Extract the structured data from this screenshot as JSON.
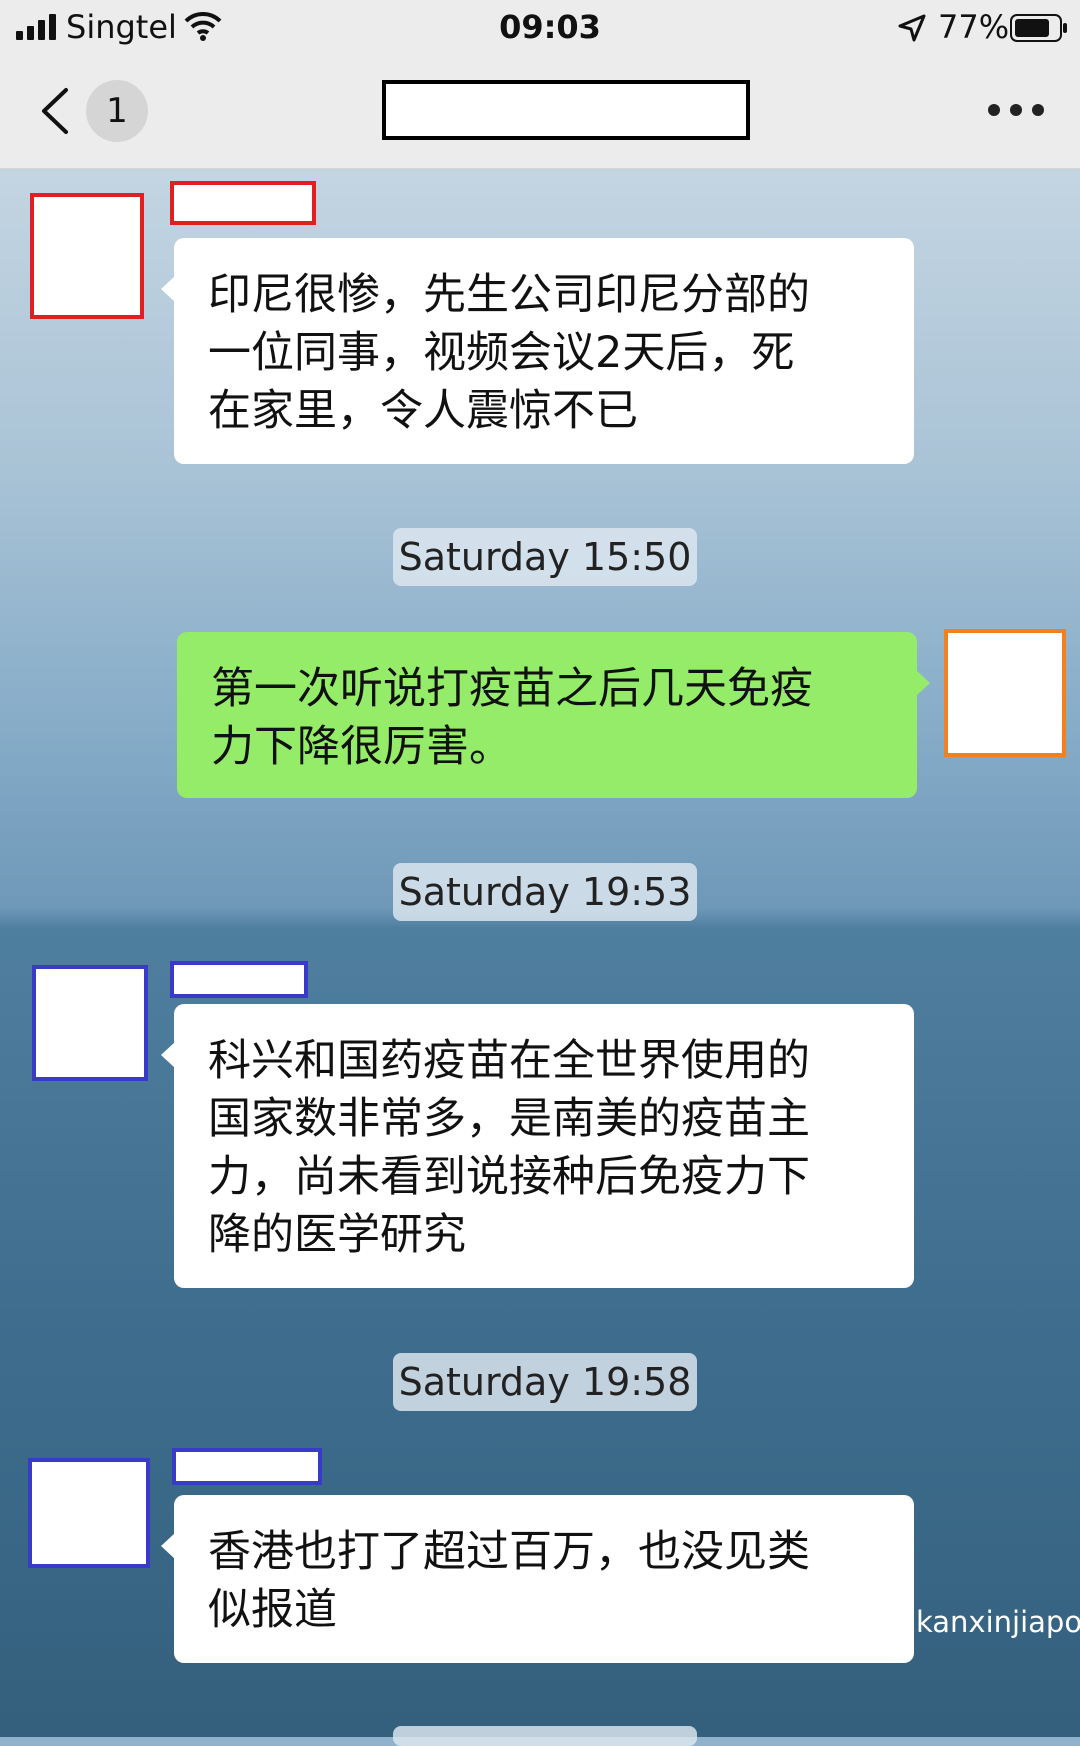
{
  "status_bar": {
    "carrier": "Singtel",
    "time": "09:03",
    "battery": "77%"
  },
  "nav": {
    "badge_count": "1",
    "more_icon": "more-dots-icon",
    "back_icon": "chevron-left-icon"
  },
  "messages": [
    {
      "side": "left",
      "text": "印尼很惨，先生公司印尼分部的一位同事，视频会议2天后，死在家里，令人震惊不已",
      "lines": [
        "印尼很惨，先生公司印尼分部的",
        "一位同事，视频会议2天后，死",
        "在家里，令人震惊不已"
      ]
    },
    {
      "side": "right",
      "text": "第一次听说打疫苗之后几天免疫力下降很厉害。",
      "lines": [
        "第一次听说打疫苗之后几天免疫",
        "力下降很厉害。"
      ]
    },
    {
      "side": "left",
      "text": "科兴和国药疫苗在全世界使用的国家数非常多，是南美的疫苗主力，尚未看到说接种后免疫力下降的医学研究",
      "lines": [
        "科兴和国药疫苗在全世界使用的",
        "国家数非常多，是南美的疫苗主",
        "力，尚未看到说接种后免疫力下",
        "降的医学研究"
      ]
    },
    {
      "side": "left",
      "text": "香港也打了超过百万，也没见类似报道",
      "lines": [
        "香港也打了超过百万，也没见类",
        "似报道"
      ]
    }
  ],
  "timestamps": [
    "Saturday 15:50",
    "Saturday 19:53",
    "Saturday 19:58"
  ],
  "watermark": {
    "text": "微信号: kanxinjiapo",
    "icon": "wechat-icon"
  },
  "colors": {
    "bubble_green": "#95ec69",
    "redact_red": "#e02020",
    "redact_orange": "#f08020",
    "redact_blue": "#3a3ac8"
  }
}
